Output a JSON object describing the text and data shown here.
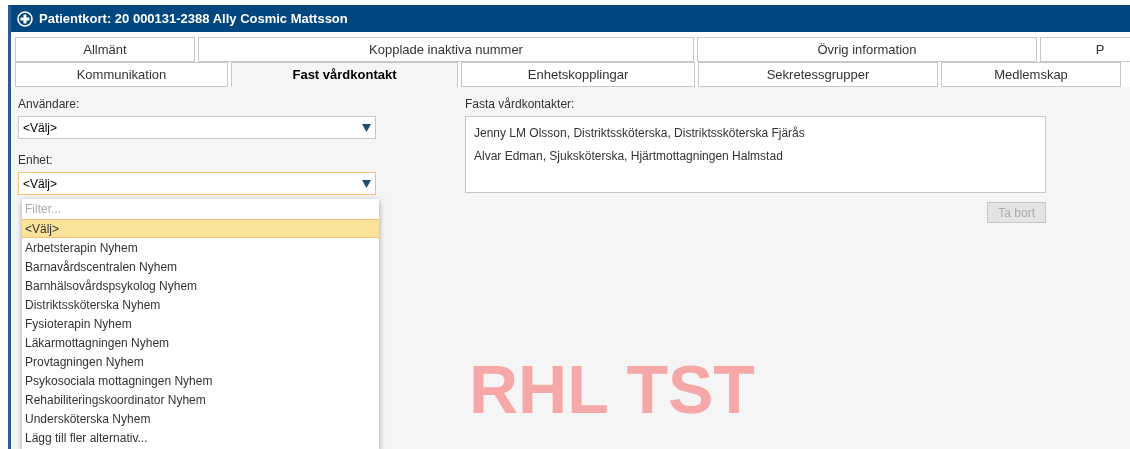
{
  "window": {
    "title": "Patientkort: 20 000131-2388 Ally Cosmic Mattsson"
  },
  "tab_rows": [
    [
      {
        "label": "Allmänt",
        "selected": false
      },
      {
        "label": "Kopplade inaktiva nummer",
        "selected": false
      },
      {
        "label": "Övrig information",
        "selected": false
      },
      {
        "label": "P",
        "selected": false
      }
    ],
    [
      {
        "label": "Kommunikation",
        "selected": false
      },
      {
        "label": "Fast vårdkontakt",
        "selected": true
      },
      {
        "label": "Enhetskopplingar",
        "selected": false
      },
      {
        "label": "Sekretessgrupper",
        "selected": false
      },
      {
        "label": "Medlemskap",
        "selected": false
      }
    ]
  ],
  "user_field": {
    "label": "Användare:",
    "value": "<Välj>",
    "focused": false
  },
  "unit_field": {
    "label": "Enhet:",
    "value": "<Välj>",
    "focused": true
  },
  "unit_dropdown": {
    "filter_placeholder": "Filter...",
    "options": [
      {
        "label": "<Välj>",
        "selected": true
      },
      {
        "label": "Arbetsterapin Nyhem",
        "selected": false
      },
      {
        "label": "Barnavårdscentralen Nyhem",
        "selected": false
      },
      {
        "label": "Barnhälsovårdspsykolog Nyhem",
        "selected": false
      },
      {
        "label": "Distriktssköterska Nyhem",
        "selected": false
      },
      {
        "label": "Fysioterapin Nyhem",
        "selected": false
      },
      {
        "label": "Läkarmottagningen Nyhem",
        "selected": false
      },
      {
        "label": "Provtagningen Nyhem",
        "selected": false
      },
      {
        "label": "Psykosociala mottagningen Nyhem",
        "selected": false
      },
      {
        "label": "Rehabiliteringskoordinator Nyhem",
        "selected": false
      },
      {
        "label": "Undersköterska Nyhem",
        "selected": false
      },
      {
        "label": "Lägg till fler alternativ...",
        "selected": false
      }
    ]
  },
  "contacts": {
    "label": "Fasta vårdkontakter:",
    "items": [
      "Jenny LM Olsson, Distriktssköterska, Distriktssköterska Fjärås",
      "Alvar Edman, Sjuksköterska, Hjärtmottagningen Halmstad"
    ]
  },
  "remove_button": {
    "label": "Ta bort",
    "disabled": true
  },
  "environment_label": "RHL TST"
}
